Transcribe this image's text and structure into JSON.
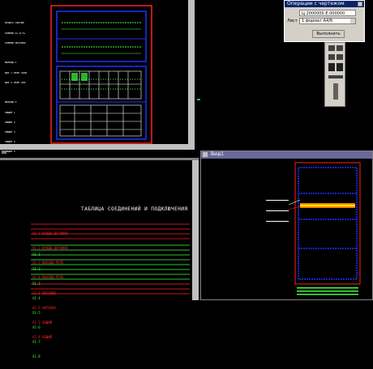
{
  "dialog": {
    "title": "Операции с чертежом",
    "field_label": "Лист",
    "field_value": "Ц.2000000.Е.000000",
    "select_value": "1 формат А4/б",
    "ok_label": "Выполнить"
  },
  "palette_icons": [
    "copy-icon",
    "sheets-icon",
    "pointer-icon",
    "connector-icon",
    "grid-icon",
    "text-icon",
    "lines-icon",
    "column-icon"
  ],
  "left_panel": {
    "labels": [
      "ВОЗДУХ СЖАТЫЙ",
      "КЛЕММЫ П+ И Н+",
      "КЛЕММЫ ПИТАНИЯ",
      "ВЫХОДЫ 1",
      "ВЫХ 1 РЕЛЕ 220В",
      "ВЫХ 2 РЕЛЕ 24В",
      "ВЫХОДЫ 2",
      "ОБЩИЙ 1",
      "ОБЩИЙ 2",
      "ОБЩИЙ 3",
      "ОБЩИЙ 4",
      "ОБЩИЙ 5"
    ]
  },
  "bottom_left": {
    "heading": "ТАБЛИЦА СОЕДИНЕНИЙ И ПОДКЛЮЧЕНИЯ",
    "red_rows_top": [
      "А1-1 ВХОДЫ-ДАТЧИКИ",
      "А1-2 ВХОДЫ-ДАТЧИКИ",
      "А1-3 ВЫХОДЫ-РЕЛЕ",
      "А1-4 ВЫХОДЫ-РЕЛЕ"
    ],
    "green_rows": [
      "Х1-1",
      "Х1-2",
      "Х1-3",
      "Х1-4",
      "Х1-5",
      "Х1-6",
      "Х1-7",
      "Х1-8"
    ],
    "red_rows_bottom": [
      "А2-1 ПИТАНИЕ",
      "А2-2 ПИТАНИЕ",
      "А2-3 ОБЩИЙ",
      "А2-4 ОБЩИЙ"
    ]
  },
  "bottom_right": {
    "title": "Вид1"
  },
  "colors": {
    "red": "#ff2020",
    "blue": "#2030ff",
    "green": "#40ff40",
    "orange": "#ff8000",
    "yellow": "#ffff00"
  }
}
